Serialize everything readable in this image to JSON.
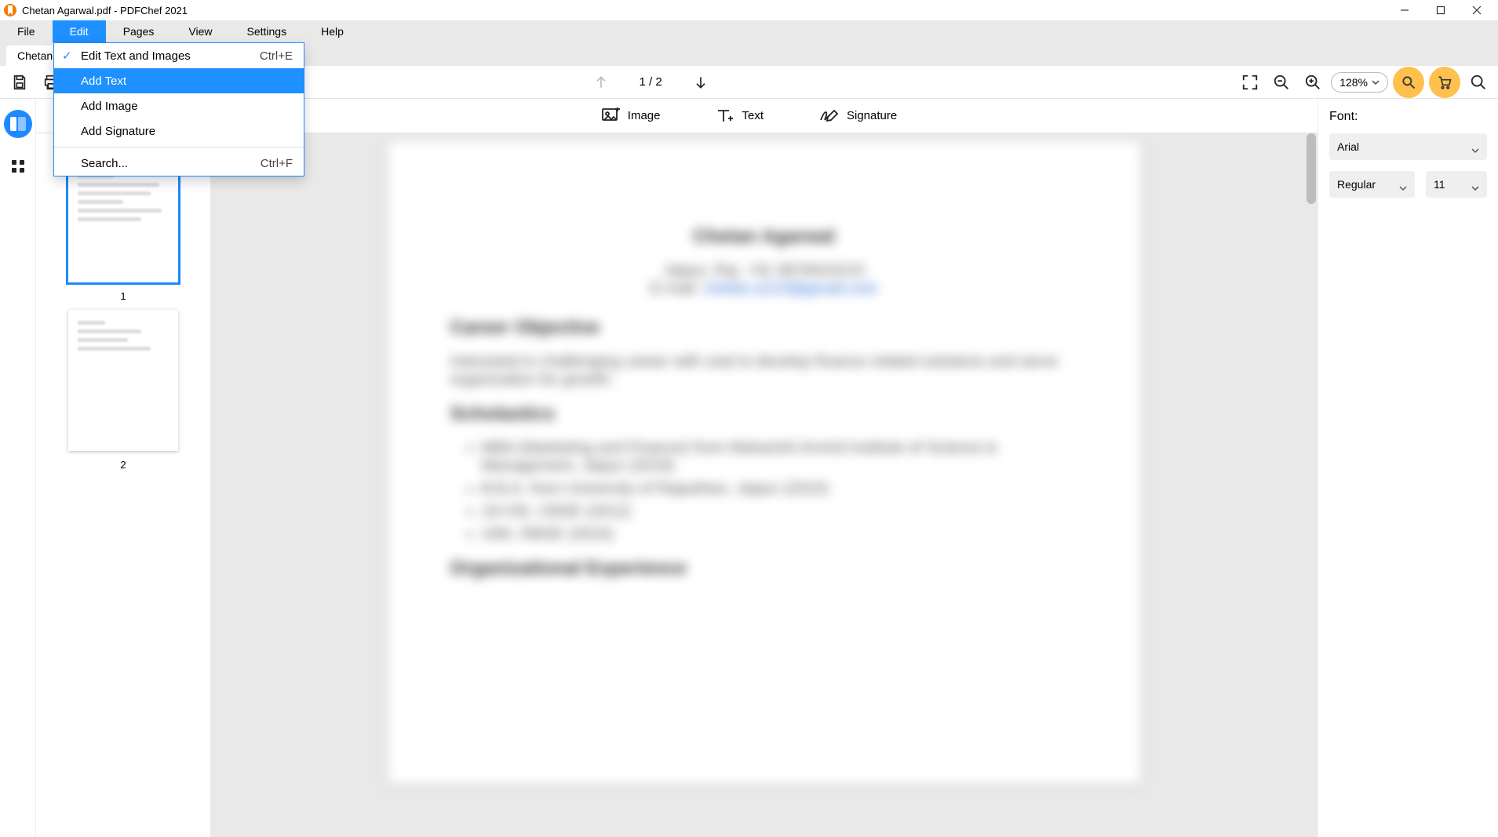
{
  "window": {
    "title": "Chetan Agarwal.pdf - PDFChef 2021"
  },
  "menus": {
    "file": "File",
    "edit": "Edit",
    "pages": "Pages",
    "view": "View",
    "settings": "Settings",
    "help": "Help"
  },
  "edit_menu": {
    "edit_text_images": {
      "label": "Edit Text and Images",
      "shortcut": "Ctrl+E",
      "checked": true
    },
    "add_text": {
      "label": "Add Text"
    },
    "add_image": {
      "label": "Add Image"
    },
    "add_sig": {
      "label": "Add Signature"
    },
    "search": {
      "label": "Search...",
      "shortcut": "Ctrl+F"
    }
  },
  "tabs": {
    "current": "Chetan Agarwal.pdf"
  },
  "toolbar": {
    "page_counter": "1 / 2",
    "zoom": "128%"
  },
  "edit_toolbar": {
    "image": "Image",
    "text": "Text",
    "signature": "Signature"
  },
  "thumbnails": {
    "page1": "1",
    "page2": "2"
  },
  "right_panel": {
    "font_label": "Font:",
    "font_family": "Arial",
    "font_weight": "Regular",
    "font_size": "11"
  },
  "doc": {
    "name": "Chetan Agarwal",
    "line1": "Jaipur, Raj.   +91 9876543210",
    "email_lbl": "E-mail: ",
    "email": "chetan.a123@gmail.com",
    "career_h": "Career Objective",
    "career_p": "Interested in challenging career with zeal to develop finance related solutions and serve organization for growth.",
    "schol_h": "Scholastics",
    "b1": "MBA (Marketing and Finance) from Maharishi Arvind Institute of Science & Management, Jaipur (2019)",
    "b2": "B.B.A. from University of Rajasthan, Jaipur (2015)",
    "b3": "10+2th, CBSE (2012)",
    "b4": "10th, RBSE (2010)",
    "org_h": "Organizational Experience"
  }
}
